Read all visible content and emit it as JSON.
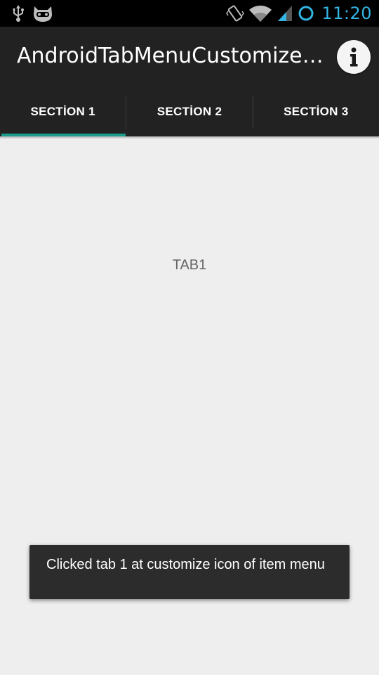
{
  "status_bar": {
    "time": "11:20",
    "icons": [
      "usb-icon",
      "cyanogen-mascot-icon",
      "vibrate-icon",
      "wifi-icon",
      "signal-icon",
      "sync-circle-icon"
    ],
    "accent_color": "#33b5e5"
  },
  "action_bar": {
    "title": "AndroidTabMenuCustomizeAc…",
    "info_icon": "info-icon"
  },
  "tabs": [
    {
      "label": "SECTİON 1",
      "active": true
    },
    {
      "label": "SECTİON 2",
      "active": false
    },
    {
      "label": "SECTİON 3",
      "active": false
    }
  ],
  "tab_indicator_color": "#1c9c8b",
  "content": {
    "label": "TAB1"
  },
  "toast": {
    "message": "Clicked tab 1 at customize icon of item menu"
  }
}
